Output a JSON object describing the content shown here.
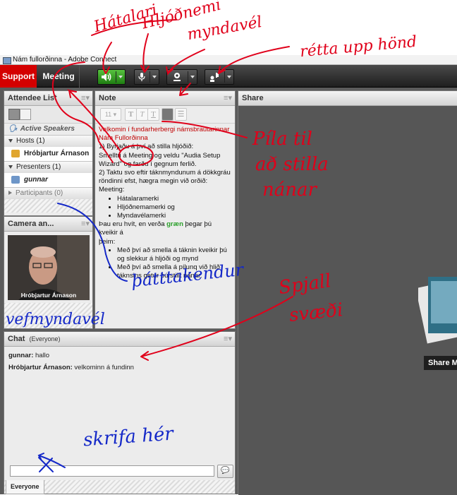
{
  "window": {
    "title": "Nám fullorðinna - Adobe Connect"
  },
  "menubar": {
    "support": "Support",
    "meeting": "Meeting"
  },
  "toolbar": {
    "speaker_icon": "speaker-icon",
    "mic_icon": "microphone-icon",
    "camera_icon": "webcam-icon",
    "raise_hand_icon": "raise-hand-icon"
  },
  "attendees": {
    "title": "Attendee List",
    "active_speakers": "Active Speakers",
    "hosts_label": "Hosts (1)",
    "host_name": "Hróbjartur Árnason",
    "presenters_label": "Presenters (1)",
    "presenter_name": "gunnar",
    "participants_label": "Participants (0)"
  },
  "camera": {
    "title": "Camera an...",
    "caption": "Hróbjartur Árnason"
  },
  "note": {
    "title": "Note",
    "font_size": "11",
    "intro1": "Velkomin í fundarherbergi námsbrautarinnar",
    "intro2": "Nám Fullorðinna",
    "step1": "1) Byrjaðu á því að stilla hljóðið:",
    "step1b": "Smelltu á Meeting og veldu \"Audia Setup",
    "step1c": "Wizard\" og farðu í gegnum ferlið.",
    "step2": "2) Taktu svo eftir táknmyndunum á dökkgráu",
    "step2b": "röndinni efst, hægra megin við orðið: Meeting:",
    "bullets": [
      "Hátalaramerki",
      "Hljóðnemamerki og",
      "Myndavélamerki"
    ],
    "after1": "Þau eru hvít, en verða ",
    "after_green": "græn",
    "after2": " þegar þú kveikir á",
    "after3": "þeim:",
    "bullets2": [
      "Með því að smella á táknin kveikir þú og slekkur á hljóði og mynd",
      "Með því að smella á pílunq við hlið táknsins getur þú stillt nánar."
    ]
  },
  "share": {
    "title": "Share",
    "button": "Share My"
  },
  "chat": {
    "title": "Chat",
    "scope": "(Everyone)",
    "messages": [
      {
        "sender": "gunnar:",
        "text": " hallo"
      },
      {
        "sender": "Hróbjartur Árnason:",
        "text": " velkominn á fundinn"
      }
    ],
    "tab": "Everyone"
  },
  "annotations": {
    "hatalari": "Hátalari",
    "hljodnemi": "Hljóðnemi",
    "myndavel": "myndavél",
    "retta": "rétta upp hönd",
    "pila1": "Píla til",
    "pila2": "að stilla",
    "pila3": "nánar",
    "thatttakendur": "þátttakendur",
    "vefmyndavel": "vefmyndavél",
    "spjall1": "Spjall",
    "spjall2": "svæði",
    "skrifa": "skrifa hér"
  },
  "colors": {
    "annotation": "#e0001a",
    "annotation_blue": "#1428c8",
    "support": "#d40000"
  }
}
